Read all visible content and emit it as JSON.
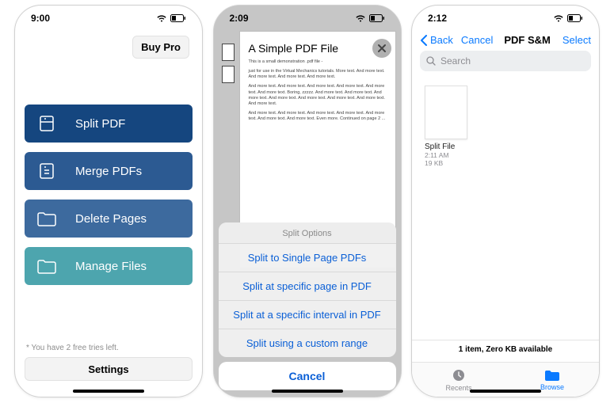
{
  "screen1": {
    "time": "9:00",
    "buy_pro": "Buy Pro",
    "actions": {
      "split": "Split PDF",
      "merge": "Merge PDFs",
      "delete": "Delete Pages",
      "manage": "Manage Files"
    },
    "footer_note": "* You have 2 free tries left.",
    "settings": "Settings"
  },
  "screen2": {
    "time": "2:09",
    "pdf_title": "A Simple PDF File",
    "pdf_sub": "This is a small demonstration .pdf file -",
    "pdf_p1": "just for use in the Virtual Mechanics tutorials. More text. And more text. And more text. And more text. And more text.",
    "pdf_p2": "And more text. And more text. And more text. And more text. And more text. And more text. Boring, zzzzz. And more text. And more text. And more text. And more text. And more text. And more text. And more text. And more text.",
    "pdf_p3": "And more text. And more text. And more text. And more text. And more text. And more text. And more text. Even more. Continued on page 2 ...",
    "sheet_title": "Split Options",
    "options": {
      "o1": "Split to Single Page PDFs",
      "o2": "Split at specific page in PDF",
      "o3": "Split at a specific interval in PDF",
      "o4": "Split using a custom range"
    },
    "cancel": "Cancel"
  },
  "screen3": {
    "time": "2:12",
    "back": "Back",
    "cancel": "Cancel",
    "title": "PDF S&M",
    "select": "Select",
    "search_placeholder": "Search",
    "file": {
      "name": "Split File",
      "time": "2:11 AM",
      "size": "19 KB"
    },
    "status": "1 item, Zero KB available",
    "tabs": {
      "recents": "Recents",
      "browse": "Browse"
    }
  }
}
